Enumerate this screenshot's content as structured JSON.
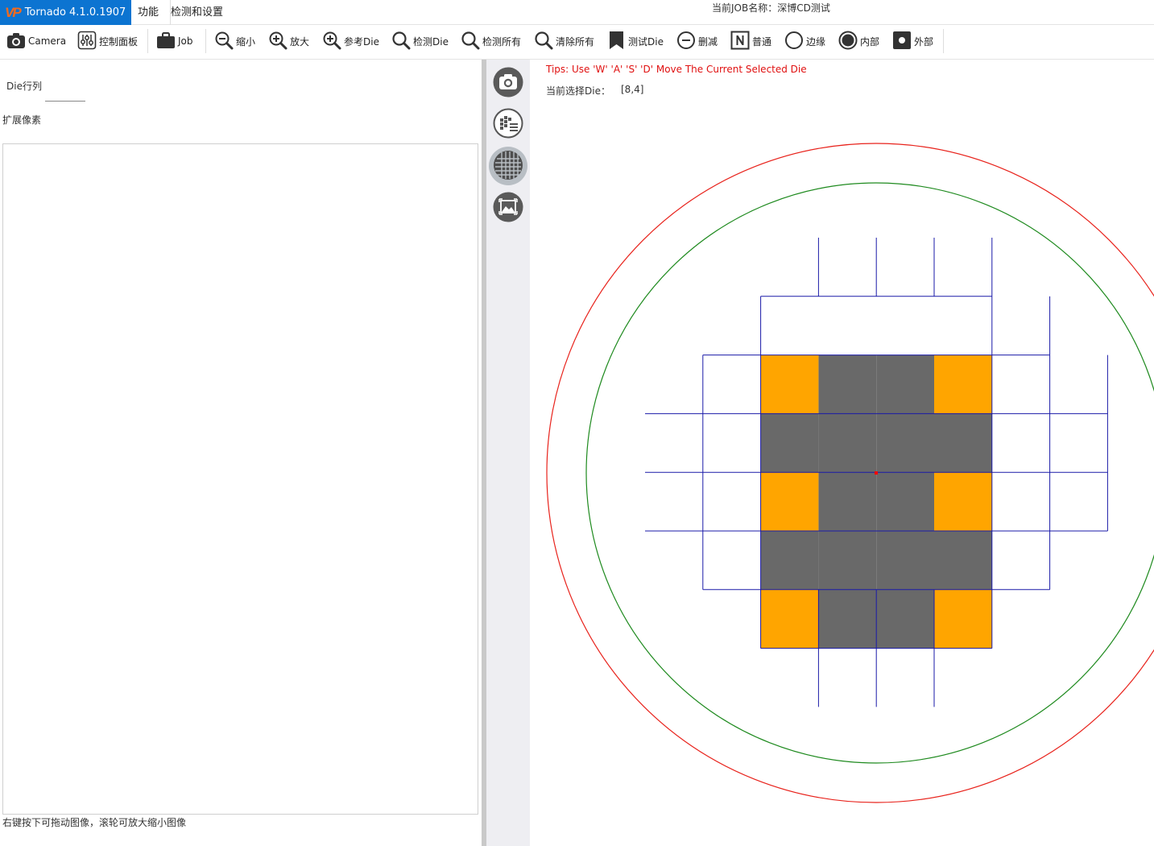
{
  "app": {
    "logo": "VP",
    "title": "Tornado 4.1.0.1907",
    "menu": [
      "功能",
      "检测和设置"
    ],
    "job_label": "当前JOB名称：",
    "job_name": "深博CD测试"
  },
  "toolbar": [
    {
      "id": "camera",
      "label": "Camera",
      "icon": "camera-icon"
    },
    {
      "id": "control-panel",
      "label": "控制面板",
      "icon": "sliders-icon"
    },
    {
      "id": "job",
      "label": "Job",
      "icon": "briefcase-icon"
    },
    {
      "id": "zoom-out",
      "label": "缩小",
      "icon": "zoom-out-icon"
    },
    {
      "id": "zoom-in",
      "label": "放大",
      "icon": "zoom-in-icon"
    },
    {
      "id": "ref-die",
      "label": "参考Die",
      "icon": "zoom-plus-icon"
    },
    {
      "id": "detect-die",
      "label": "检测Die",
      "icon": "search-icon"
    },
    {
      "id": "detect-all",
      "label": "检测所有",
      "icon": "search-icon"
    },
    {
      "id": "clear-all",
      "label": "清除所有",
      "icon": "search-icon"
    },
    {
      "id": "test-die",
      "label": "测试Die",
      "icon": "bookmark-icon"
    },
    {
      "id": "reduce",
      "label": "删减",
      "icon": "minus-circle-icon"
    },
    {
      "id": "normal",
      "label": "普通",
      "icon": "n-box-icon"
    },
    {
      "id": "edge",
      "label": "边缘",
      "icon": "ring-icon"
    },
    {
      "id": "inner",
      "label": "内部",
      "icon": "filled-ring-icon"
    },
    {
      "id": "outer",
      "label": "外部",
      "icon": "square-dot-icon"
    }
  ],
  "left": {
    "die_rowcol_label": "Die行列",
    "die_rowcol_value": "",
    "expand_pixel_label": "扩展像素",
    "hint": "右键按下可拖动图像，滚轮可放大缩小图像"
  },
  "strip": [
    {
      "id": "camera",
      "icon": "camera-icon",
      "selected": false
    },
    {
      "id": "die-map",
      "icon": "die-list-icon",
      "selected": false
    },
    {
      "id": "wafer-grid",
      "icon": "wafer-grid-icon",
      "selected": true
    },
    {
      "id": "image-frame",
      "icon": "image-frame-icon",
      "selected": false
    }
  ],
  "wafer": {
    "tips": "Tips: Use 'W' 'A' 'S' 'D' Move The Current Selected Die",
    "selected_label": "当前选择Die：",
    "selected_value": "[8,4]",
    "colors": {
      "outer_ring": "#e8221b",
      "inner_ring": "#1e8a1e",
      "grid": "#1a1aa8",
      "reference": "#ffa500",
      "test": "#696969",
      "center": "#ff0000"
    },
    "reference_dies": [
      [
        2,
        2
      ],
      [
        2,
        5
      ],
      [
        4,
        2
      ],
      [
        4,
        5
      ],
      [
        6,
        2
      ],
      [
        6,
        5
      ]
    ],
    "test_dies": [
      [
        2,
        3
      ],
      [
        2,
        4
      ],
      [
        3,
        2
      ],
      [
        3,
        3
      ],
      [
        3,
        4
      ],
      [
        3,
        5
      ],
      [
        4,
        3
      ],
      [
        4,
        4
      ],
      [
        5,
        2
      ],
      [
        5,
        3
      ],
      [
        5,
        4
      ],
      [
        5,
        5
      ],
      [
        6,
        3
      ],
      [
        6,
        4
      ]
    ]
  }
}
